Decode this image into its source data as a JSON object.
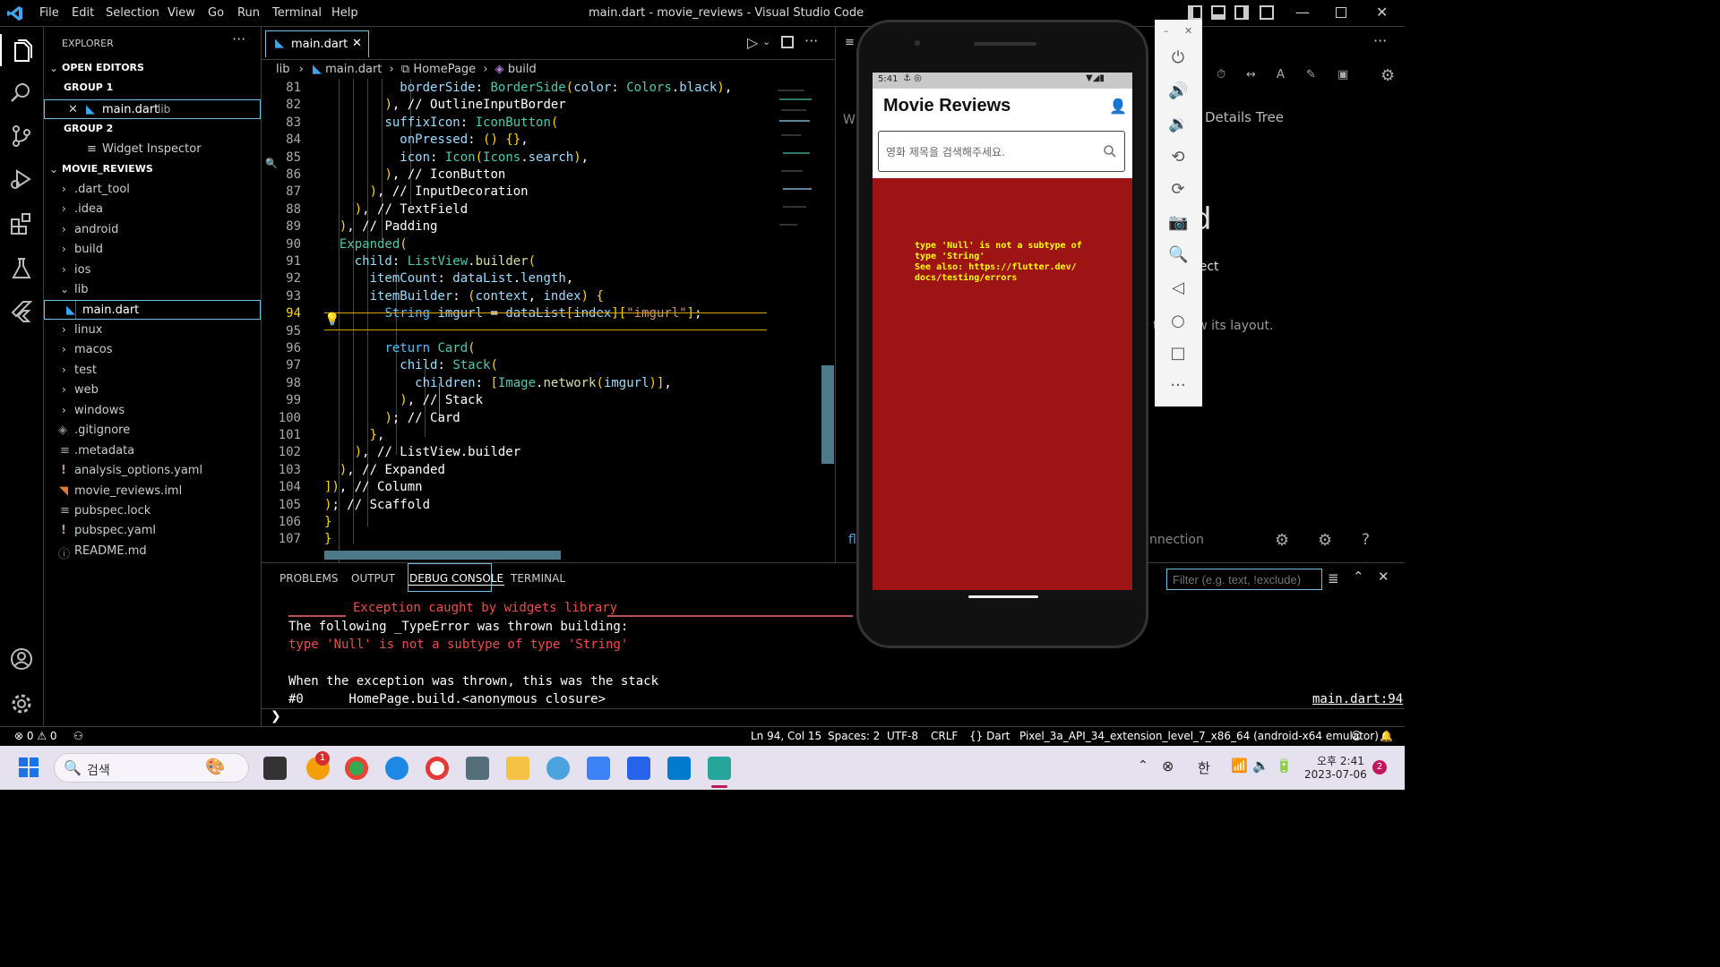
{
  "titlebar": {
    "menu": [
      "File",
      "Edit",
      "Selection",
      "View",
      "Go",
      "Run",
      "Terminal",
      "Help"
    ],
    "title": "main.dart - movie_reviews - Visual Studio Code"
  },
  "sidebar": {
    "header": "EXPLORER",
    "open_editors": "OPEN EDITORS",
    "group1": "GROUP 1",
    "group1_file": "main.dart",
    "group1_file_dir": "lib",
    "group2": "GROUP 2",
    "group2_file": "Widget Inspector",
    "project": "MOVIE_REVIEWS",
    "folders": [
      ".dart_tool",
      ".idea",
      "android",
      "build",
      "ios",
      "lib"
    ],
    "lib_file": "main.dart",
    "folders2": [
      "linux",
      "macos",
      "test",
      "web",
      "windows"
    ],
    "files": [
      ".gitignore",
      ".metadata",
      "analysis_options.yaml",
      "movie_reviews.iml",
      "pubspec.lock",
      "pubspec.yaml",
      "README.md"
    ]
  },
  "editor": {
    "tab": "main.dart",
    "breadcrumb": [
      "lib",
      "main.dart",
      "HomePage",
      "build"
    ],
    "lines": [
      {
        "n": "81",
        "t": "          borderSide: BorderSide(color: Colors.black),"
      },
      {
        "n": "82",
        "t": "        ), // OutlineInputBorder"
      },
      {
        "n": "83",
        "t": "        suffixIcon: IconButton("
      },
      {
        "n": "84",
        "t": "          onPressed: () {},"
      },
      {
        "n": "85",
        "t": "          icon: Icon(Icons.search),"
      },
      {
        "n": "86",
        "t": "        ), // IconButton"
      },
      {
        "n": "87",
        "t": "      ), // InputDecoration"
      },
      {
        "n": "88",
        "t": "    ), // TextField"
      },
      {
        "n": "89",
        "t": "  ), // Padding"
      },
      {
        "n": "90",
        "t": "  Expanded("
      },
      {
        "n": "91",
        "t": "    child: ListView.builder("
      },
      {
        "n": "92",
        "t": "      itemCount: dataList.length,"
      },
      {
        "n": "93",
        "t": "      itemBuilder: (context, index) {"
      },
      {
        "n": "94",
        "t": "        String imgurl = dataList[index][\"imgurl\"];"
      },
      {
        "n": "95",
        "t": ""
      },
      {
        "n": "96",
        "t": "        return Card("
      },
      {
        "n": "97",
        "t": "          child: Stack("
      },
      {
        "n": "98",
        "t": "            children: [Image.network(imgurl)],"
      },
      {
        "n": "99",
        "t": "          ), // Stack"
      },
      {
        "n": "100",
        "t": "        ); // Card"
      },
      {
        "n": "101",
        "t": "      },"
      },
      {
        "n": "102",
        "t": "    ), // ListView.builder"
      },
      {
        "n": "103",
        "t": "  ), // Expanded"
      },
      {
        "n": "104",
        "t": "]), // Column"
      },
      {
        "n": "105",
        "t": "); // Scaffold"
      },
      {
        "n": "106",
        "t": "}"
      },
      {
        "n": "107",
        "t": "}"
      }
    ]
  },
  "panel": {
    "tabs": [
      "PROBLEMS",
      "OUTPUT",
      "DEBUG CONSOLE",
      "TERMINAL"
    ],
    "console": [
      "Exception caught by widgets library",
      "The following _TypeError was thrown building:",
      "type 'Null' is not a subtype of type 'String'",
      "",
      "When the exception was thrown, this was the stack",
      "#0      HomePage.build.<anonymous closure>"
    ],
    "filter_placeholder": "Filter (e.g. text, !exclude)",
    "link": "main.dart:94"
  },
  "devtools": {
    "details_tree": "Details Tree",
    "partial1": "d",
    "partial2": "nnect",
    "partial3": "t to view its layout.",
    "partial4": "nnection",
    "partial5": "W",
    "partial6": "fl"
  },
  "phone": {
    "time": "5:41",
    "app_title": "Movie Reviews",
    "search_placeholder": "영화 제목을 검색해주세요.",
    "error": "type 'Null' is not a subtype of\ntype 'String'\nSee also: https://flutter.dev/\ndocs/testing/errors"
  },
  "statusbar": {
    "errors": "0",
    "warnings": "0",
    "position": "Ln 94, Col 15",
    "spaces": "Spaces: 2",
    "encoding": "UTF-8",
    "eol": "CRLF",
    "language": "Dart",
    "device": "Pixel_3a_API_34_extension_level_7_x86_64 (android-x64 emulator)"
  },
  "taskbar": {
    "search": "검색",
    "lang": "한",
    "time": "오후 2:41",
    "date": "2023-07-06",
    "notif": "2",
    "badge": "1"
  },
  "colors": {
    "accent": "#6fc3df",
    "error_bg": "#9e1414",
    "error_text": "#ffff00"
  }
}
